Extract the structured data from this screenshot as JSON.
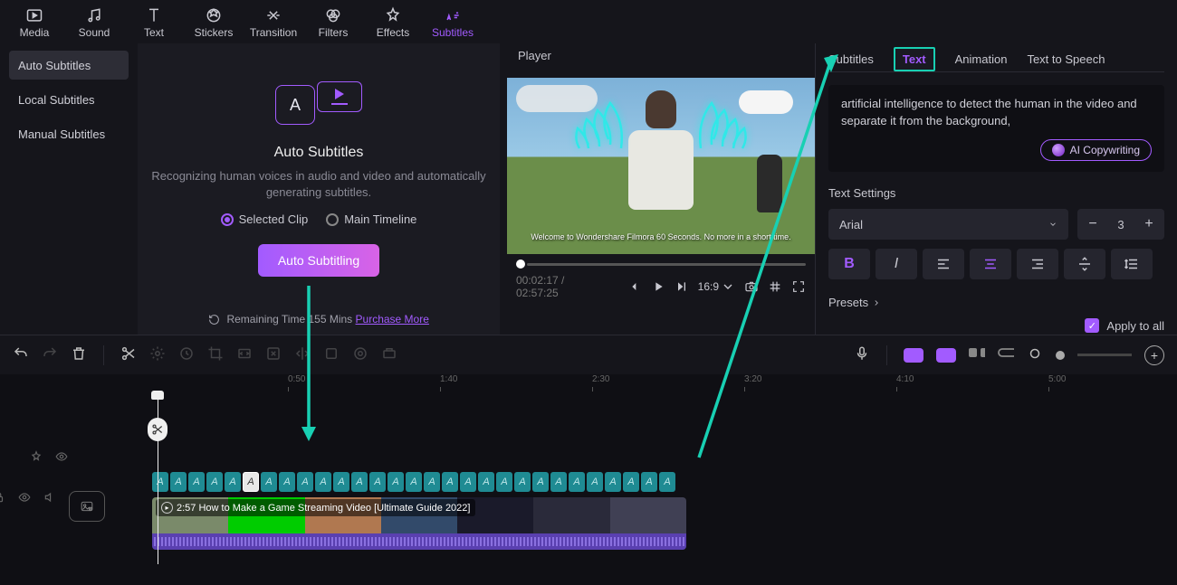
{
  "top_tabs": {
    "media": "Media",
    "sound": "Sound",
    "text": "Text",
    "stickers": "Stickers",
    "transition": "Transition",
    "filters": "Filters",
    "effects": "Effects",
    "subtitles": "Subtitles"
  },
  "sidebar": {
    "auto": "Auto Subtitles",
    "local": "Local Subtitles",
    "manual": "Manual Subtitles"
  },
  "auto_panel": {
    "title": "Auto Subtitles",
    "desc": "Recognizing human voices in audio and video and automatically generating subtitles.",
    "opt_selected": "Selected Clip",
    "opt_main": "Main Timeline",
    "action": "Auto Subtitling",
    "remain_label": "Remaining Time",
    "remain_mins": "155 Mins",
    "purchase": "Purchase More"
  },
  "player": {
    "label": "Player",
    "overlay_sub": "Welcome to Wondershare Filmora 60 Seconds. No more in a short time.",
    "time_cur": "00:02:17",
    "time_total": "02:57:25",
    "aspect": "16:9"
  },
  "inspector": {
    "tabs": {
      "subtitles": "Subtitles",
      "text": "Text",
      "animation": "Animation",
      "tts": "Text to Speech"
    },
    "subtitle_text": "artificial intelligence to detect the human in the video and separate it from the background,",
    "ai_copy": "AI Copywriting",
    "text_settings": "Text Settings",
    "font": "Arial",
    "size": "3",
    "presets": "Presets",
    "apply": "Apply to all"
  },
  "ruler": {
    "m0_50": "0:50",
    "m1_40": "1:40",
    "m2_30": "2:30",
    "m3_20": "3:20",
    "m4_10": "4:10",
    "m5_00": "5:00"
  },
  "timeline": {
    "clip_title": "2:57 How to Make a Game Streaming Video [Ultimate Guide 2022]"
  }
}
